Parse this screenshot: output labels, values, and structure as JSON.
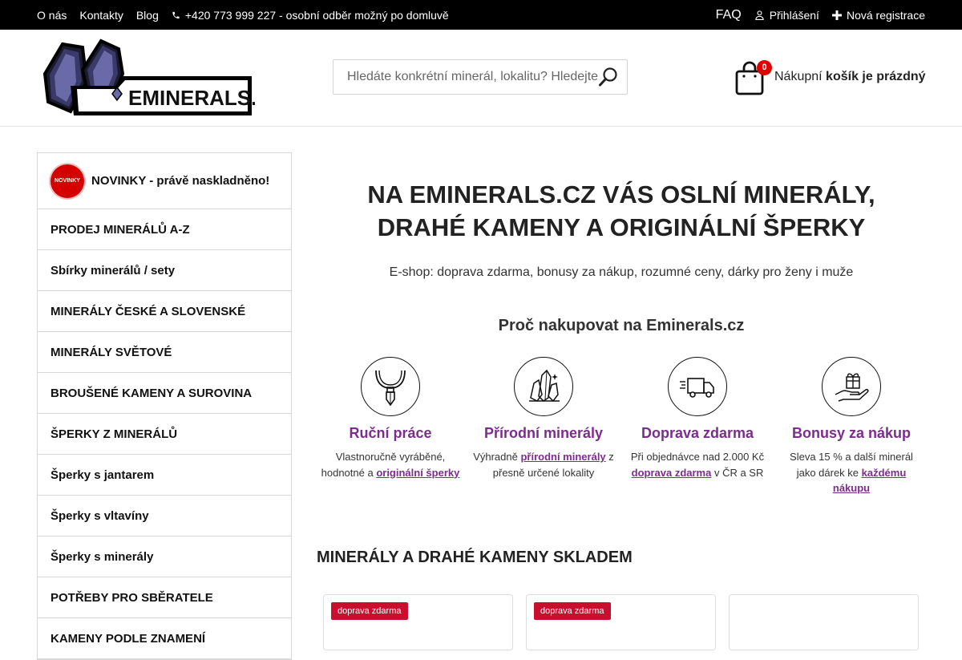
{
  "topbar": {
    "links": [
      "O nás",
      "Kontakty",
      "Blog"
    ],
    "phone": "+420 773 999 227 - osobní odběr možný po domluvě",
    "faq": "FAQ",
    "login": "Přihlášení",
    "register": "Nová registrace"
  },
  "header": {
    "logo_alt": "EMINERALS.CZ",
    "search_placeholder": "Hledáte konkrétní minerál, lokalitu? Hledejte",
    "cart_count": "0",
    "cart_label_prefix": "Nákupní",
    "cart_label_status": "košík je prázdný"
  },
  "sidebar": {
    "novinky_badge": "NOVINKY",
    "items": [
      "NOVINKY - právě naskladněno!",
      "PRODEJ MINERÁLŮ A-Z",
      "Sbírky minerálů / sety",
      "MINERÁLY ČESKÉ A SLOVENSKÉ",
      "MINERÁLY SVĚTOVÉ",
      "BROUŠENÉ KAMENY A SUROVINA",
      "ŠPERKY Z MINERÁLŮ",
      "Šperky s jantarem",
      "Šperky s vltavíny",
      "Šperky s minerály",
      "POTŘEBY PRO SBĚRATELE",
      "KAMENY PODLE ZNAMENÍ"
    ]
  },
  "main": {
    "hero_title_line1": "NA EMINERALS.CZ VÁS OSLNÍ MINERÁLY,",
    "hero_title_line2": "DRAHÉ KAMENY A ORIGINÁLNÍ ŠPERKY",
    "hero_subtitle": "E-shop: doprava zdarma, bonusy za nákup, rozumné ceny, dárky pro ženy i muže",
    "why_title": "Proč nakupovat na Eminerals.cz",
    "features": [
      {
        "icon": "pendant-icon",
        "title": "Ruční práce",
        "text1": "Vlastnoručně vyráběné, hodnotné a ",
        "link": "originální šperky",
        "text2": ""
      },
      {
        "icon": "crystal-icon",
        "title": "Přírodní minerály",
        "text1": "Výhradně ",
        "link": "přírodní minerály",
        "text2": " z přesně určené lokality"
      },
      {
        "icon": "truck-icon",
        "title": "Doprava zdarma",
        "text1": "Při objednávce nad 2.000 Kč ",
        "link": "doprava zdarma",
        "text2": " v ČR a SR"
      },
      {
        "icon": "gift-hand-icon",
        "title": "Bonusy za nákup",
        "text1": "Sleva 15 % a další minerál jako dárek ke ",
        "link": "každému nákupu",
        "text2": ""
      }
    ],
    "stock_title": "MINERÁLY A DRAHÉ KAMENY SKLADEM",
    "cards": [
      {
        "tag": "doprava zdarma"
      },
      {
        "tag": "doprava zdarma"
      },
      {
        "tag": ""
      }
    ]
  },
  "colors": {
    "accent": "#7b2d8b",
    "topbar_bg": "#000000",
    "badge_red": "#e00000",
    "tag_red": "#c8102e"
  }
}
